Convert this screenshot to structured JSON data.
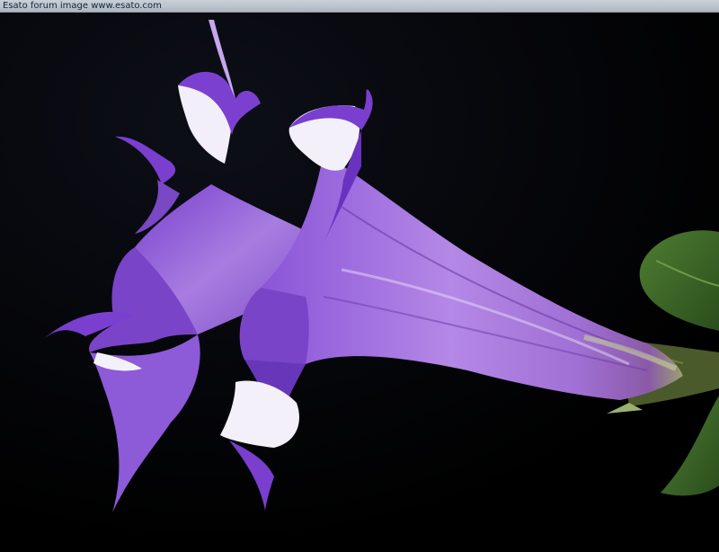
{
  "caption": {
    "text": "Esato forum image www.esato.com"
  },
  "colors": {
    "background": "#000000",
    "petal_purple": "#8a4fd0",
    "petal_dark": "#5a2a9a",
    "petal_white": "#f4f0fa",
    "leaf_green": "#3e6b2a"
  },
  "image": {
    "subject_icon": "flower-photo"
  }
}
